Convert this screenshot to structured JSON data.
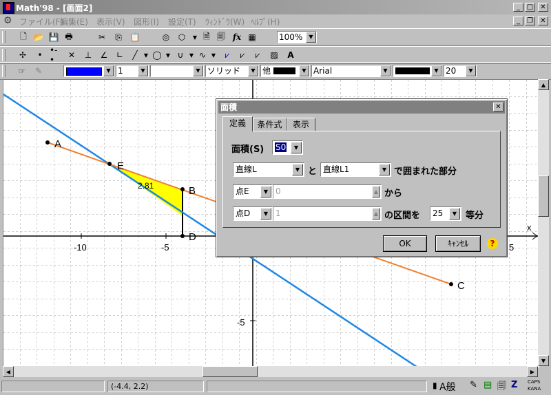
{
  "window": {
    "title": "Math'98 - [画面2]"
  },
  "menu": [
    "ファイル(F)",
    "編集(E)",
    "表示(V)",
    "図形(I)",
    "設定(T)",
    "ｳｨﾝﾄﾞｳ(W)",
    "ﾍﾙﾌﾟ(H)"
  ],
  "toolbar1": {
    "zoom": "100%"
  },
  "toolbar3": {
    "line_width": "1",
    "line_style": "ソリッド",
    "other_label": "他",
    "font": "Arial",
    "font_size": "20",
    "colors": {
      "line": "#0000ff",
      "fill": "#000000",
      "text": "#000000"
    }
  },
  "canvas": {
    "point_labels": {
      "a": "A",
      "b": "B",
      "c": "C",
      "d": "D",
      "e": "E"
    },
    "area_value": "2.81",
    "x_tick_labels": [
      "-10",
      "-5",
      "5"
    ],
    "y_tick_labels": [
      "-5"
    ],
    "x_axis_label": "x"
  },
  "dialog": {
    "title": "面積",
    "tabs": [
      "定義",
      "条件式",
      "表示"
    ],
    "area_label": "面積(S)",
    "area_name": "S0",
    "line1": "直線L",
    "conj": "と",
    "line2": "直線L1",
    "enclosed_label": "で囲まれた部分",
    "from_point": "点E",
    "from_value": "0",
    "from_label": "から",
    "to_point": "点D",
    "to_value": "1",
    "interval_label": "の区間を",
    "divisions": "25",
    "equal_label": "等分",
    "ok": "OK",
    "cancel": "ｷｬﾝｾﾙ"
  },
  "status": {
    "coords": "(-4.4, 2.2)",
    "caps": "CAPS",
    "kana": "KANA"
  }
}
